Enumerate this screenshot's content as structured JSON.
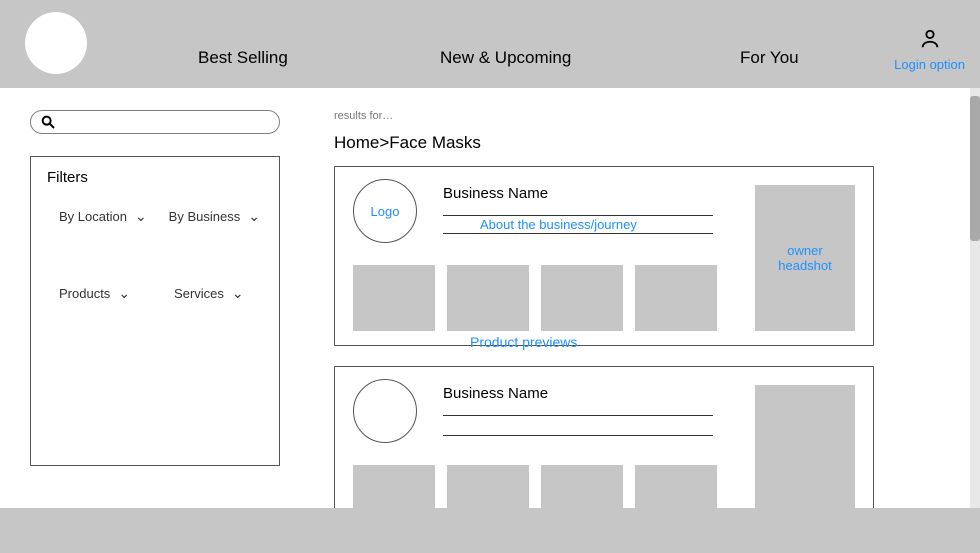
{
  "colors": {
    "accent": "#1e90ff"
  },
  "topnav": {
    "best_selling": "Best Selling",
    "new_upcoming": "New & Upcoming",
    "for_you": "For You",
    "login_label": "Login option"
  },
  "search": {
    "placeholder": ""
  },
  "filters": {
    "title": "Filters",
    "by_location": "By Location",
    "by_business": "By Business",
    "products": "Products",
    "services": "Services"
  },
  "results_for_label": "results for…",
  "breadcrumb": {
    "home": "Home",
    "sep": ">",
    "current": "Face Masks"
  },
  "card_labels": {
    "logo_placeholder": "Logo",
    "business_name": "Business Name",
    "about_link": "About the business/journey",
    "owner_headshot": "owner headshot",
    "product_previews": "Product previews"
  },
  "results": [
    {
      "business_name": "Business Name"
    },
    {
      "business_name": "Business Name"
    }
  ]
}
